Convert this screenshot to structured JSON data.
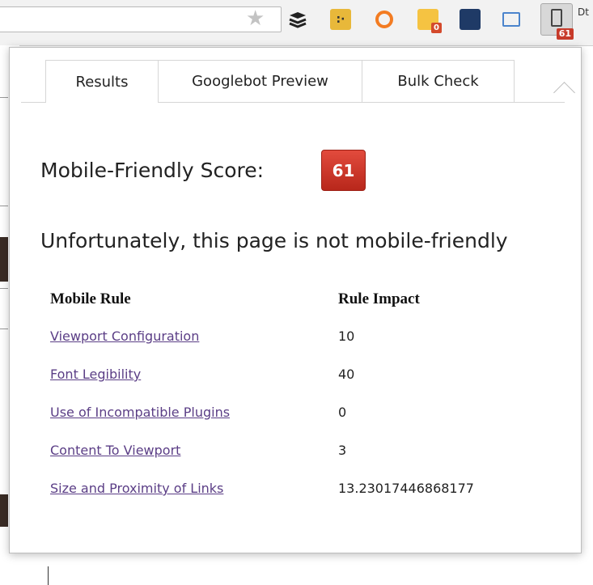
{
  "toolbar": {
    "mobile_badge": "61",
    "chart_badge": "0",
    "right_clip": "Dt"
  },
  "tabs": [
    {
      "label": "Results"
    },
    {
      "label": "Googlebot Preview"
    },
    {
      "label": "Bulk Check"
    }
  ],
  "score": {
    "label": "Mobile-Friendly Score:",
    "value": "61",
    "color": "#d23a2c"
  },
  "verdict": "Unfortunately, this page is not mobile-friendly",
  "rules_table": {
    "headers": [
      "Mobile Rule",
      "Rule Impact"
    ],
    "rows": [
      {
        "rule": "Viewport Configuration",
        "impact": "10"
      },
      {
        "rule": "Font Legibility",
        "impact": "40"
      },
      {
        "rule": "Use of Incompatible Plugins",
        "impact": "0"
      },
      {
        "rule": "Content To Viewport",
        "impact": "3"
      },
      {
        "rule": "Size and Proximity of Links",
        "impact": "13.23017446868177"
      }
    ]
  },
  "icons": [
    "star-icon",
    "buffer-icon",
    "toggl-icon",
    "ring-icon",
    "chart-icon",
    "speed-icon",
    "cast-icon",
    "mobile-phone-icon"
  ]
}
